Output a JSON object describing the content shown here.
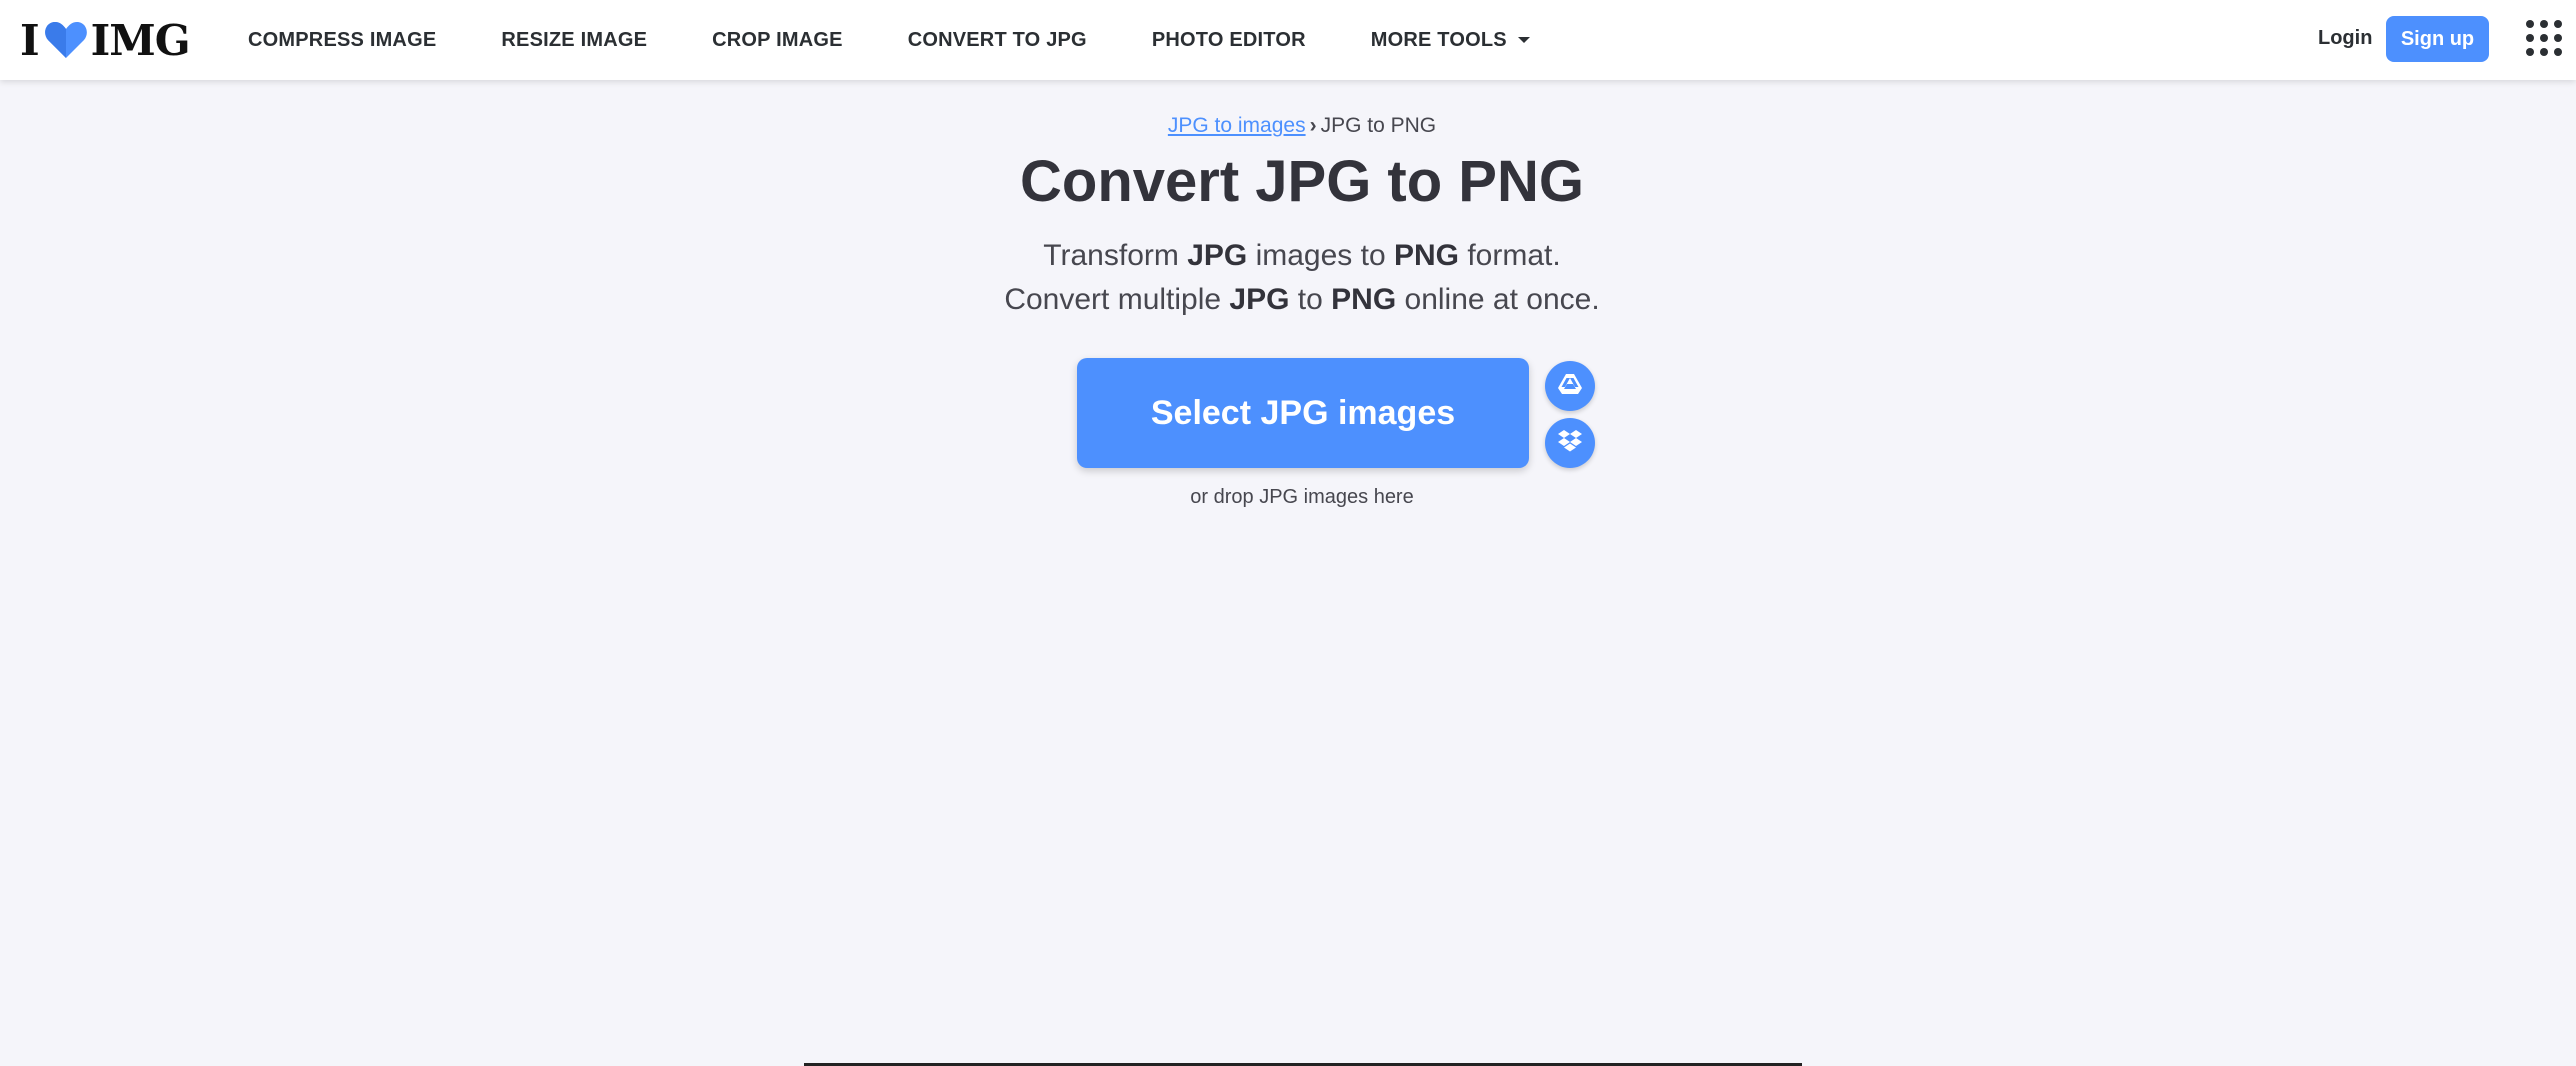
{
  "header": {
    "logo": {
      "left": "I",
      "right": "IMG"
    },
    "nav": [
      {
        "label": "COMPRESS IMAGE"
      },
      {
        "label": "RESIZE IMAGE"
      },
      {
        "label": "CROP IMAGE"
      },
      {
        "label": "CONVERT TO JPG"
      },
      {
        "label": "PHOTO EDITOR"
      },
      {
        "label": "MORE TOOLS"
      }
    ],
    "login_label": "Login",
    "signup_label": "Sign up"
  },
  "breadcrumb": {
    "parent": "JPG to images",
    "separator": "›",
    "current": "JPG to PNG"
  },
  "main": {
    "title": "Convert JPG to PNG",
    "subtitle_line1": {
      "a": "Transform ",
      "b": "JPG",
      "c": " images to ",
      "d": "PNG",
      "e": " format."
    },
    "subtitle_line2": {
      "a": "Convert multiple ",
      "b": "JPG",
      "c": " to ",
      "d": "PNG",
      "e": " online at once."
    },
    "select_label": "Select JPG images",
    "drop_text": "or drop JPG images here"
  },
  "icons": {
    "logo_heart": "heart-icon",
    "more_tools_caret": "caret-down-icon",
    "apps": "apps-grid-icon",
    "google_drive": "google-drive-icon",
    "dropbox": "dropbox-icon"
  },
  "colors": {
    "accent": "#4d90fe",
    "background": "#f5f5fa",
    "text": "#33333b"
  }
}
